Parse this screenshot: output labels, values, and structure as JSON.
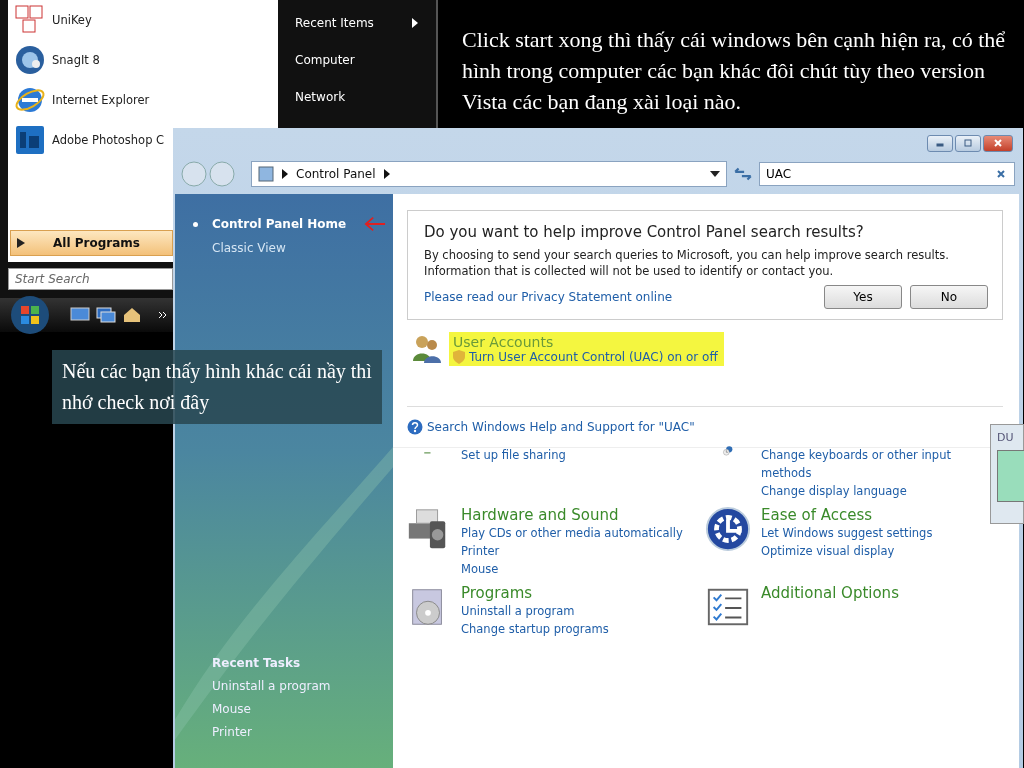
{
  "start_menu": {
    "programs": [
      {
        "label": "UniKey"
      },
      {
        "label": "SnagIt 8"
      },
      {
        "label": "Internet Explorer"
      },
      {
        "label": "Adobe Photoshop C"
      }
    ],
    "all_programs": "All Programs",
    "search": {
      "placeholder": "Start Search"
    },
    "places": [
      {
        "label": "Recent Items",
        "submenu": true
      },
      {
        "label": "Computer",
        "submenu": false
      },
      {
        "label": "Network",
        "submenu": false
      }
    ]
  },
  "caption_top": "Click start xong thì thấy cái windows bên cạnh hiện ra, có thể hình trong computer các bạn khác đôi chút tùy theo version Vista các bạn đang xài loại nào.",
  "caption_left": "Nếu các bạn thấy hình khác cái nầy thì nhớ check nơi đây",
  "control_panel": {
    "address": "Control Panel",
    "search": {
      "value": "UAC"
    },
    "sidebar": [
      {
        "label": "Control Panel Home",
        "selected": true,
        "pointer": true
      },
      {
        "label": "Classic View",
        "selected": false,
        "pointer": false
      }
    ],
    "recent_tasks": {
      "title": "Recent Tasks",
      "items": [
        "Uninstall a program",
        "Mouse",
        "Printer"
      ]
    },
    "search_results": {
      "question": "Do you want to help improve Control Panel search results?",
      "body": "By choosing to send your search queries to Microsoft, you can help improve search results. Information that is collected will not be used to identify or contact you.",
      "privacy_link": "Please read our Privacy Statement online",
      "buttons": [
        "Yes",
        "No"
      ],
      "result": {
        "title": "User Accounts",
        "link": "Turn User Account Control (UAC) on or off",
        "highlighted": true
      },
      "help_link": "Search Windows Help and Support for \"UAC\""
    },
    "categories": [
      {
        "links": [
          "Set up file sharing"
        ]
      },
      {
        "links": [
          "Change keyboards or other input methods",
          "Change display language"
        ]
      },
      {
        "title": "Hardware and Sound",
        "links": [
          "Play CDs or other media automatically",
          "Printer",
          "Mouse"
        ]
      },
      {
        "title": "Ease of Access",
        "links": [
          "Let Windows suggest settings",
          "Optimize visual display"
        ]
      },
      {
        "title": "Programs",
        "links": [
          "Uninstall a program",
          "Change startup programs"
        ]
      },
      {
        "title": "Additional Options"
      }
    ]
  },
  "gadget": {
    "label": "DU"
  }
}
